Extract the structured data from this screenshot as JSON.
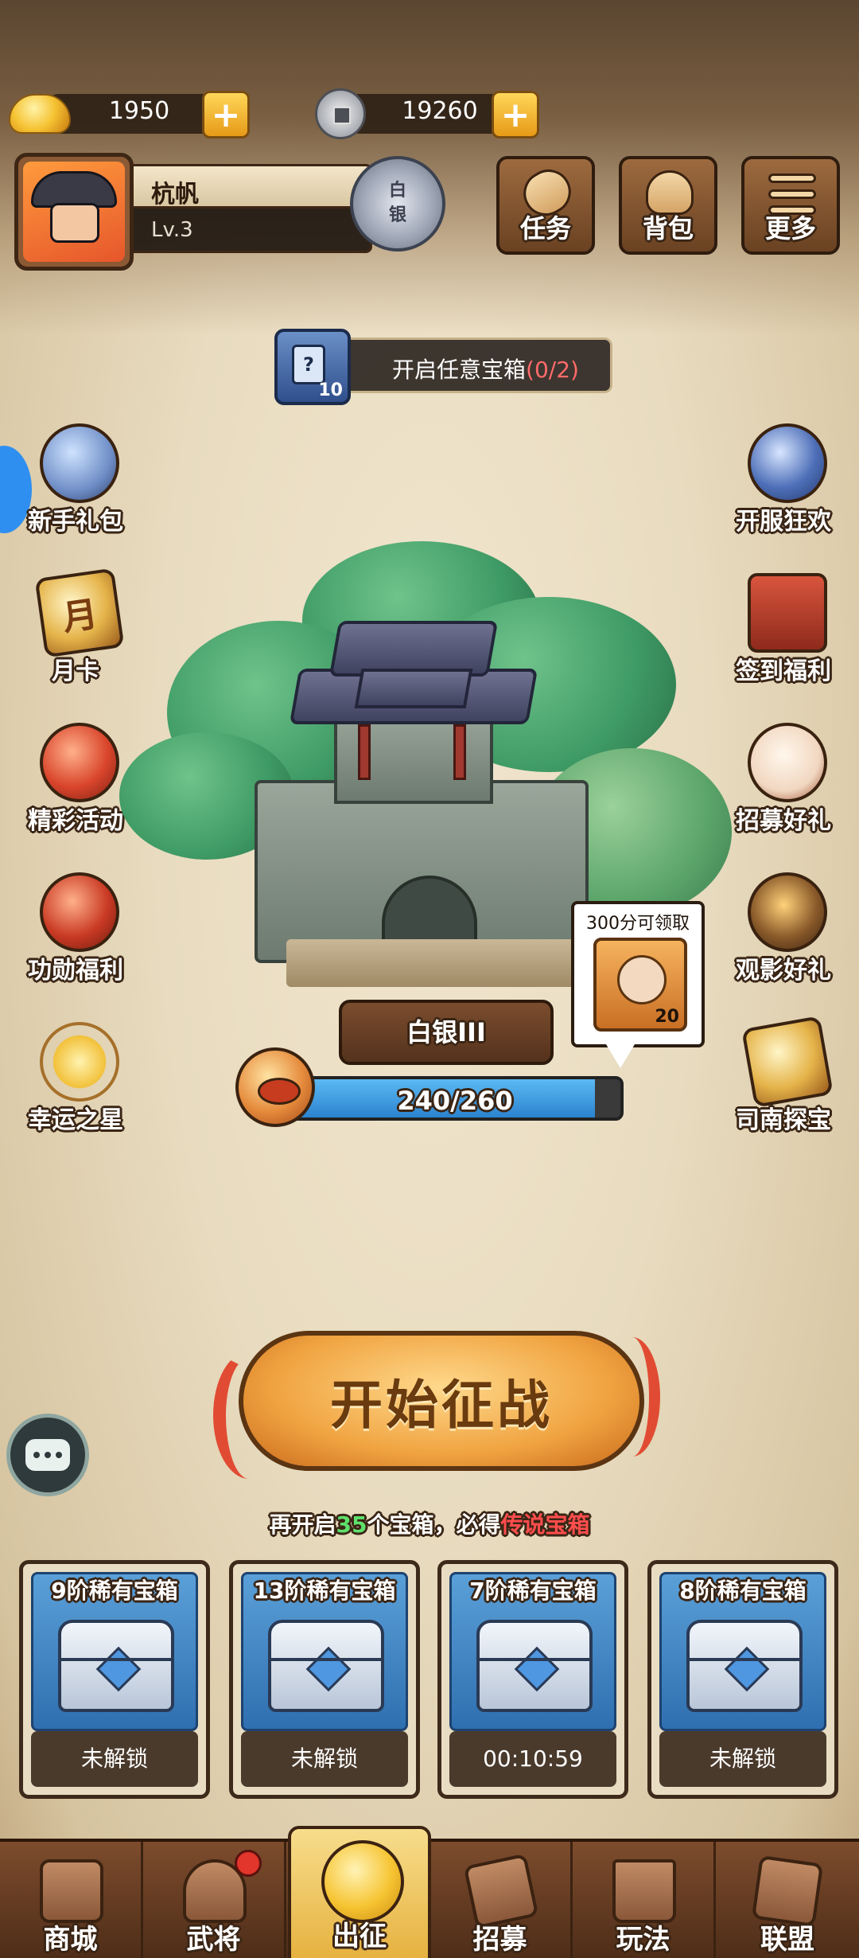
{
  "currency": {
    "gold": "1950",
    "silver": "19260"
  },
  "player": {
    "name": "杭帆",
    "level": "Lv.3",
    "rank_badge": [
      "白",
      "银"
    ]
  },
  "top_buttons": {
    "tasks": "任务",
    "bag": "背包",
    "more": "更多"
  },
  "mission": {
    "card_glyph": "?",
    "card_count": "10",
    "text": "开启任意宝箱",
    "progress": "(0/2)"
  },
  "left_activities": [
    {
      "label": "新手礼包",
      "icon": "hero-gift-icon"
    },
    {
      "label": "月卡",
      "icon": "monthly-card-icon",
      "glyph": "月"
    },
    {
      "label": "精彩活动",
      "icon": "event-bag-icon"
    },
    {
      "label": "功勋福利",
      "icon": "merit-bag-icon"
    },
    {
      "label": "幸运之星",
      "icon": "lucky-star-icon"
    }
  ],
  "right_activities": [
    {
      "label": "开服狂欢",
      "icon": "server-celebration-icon"
    },
    {
      "label": "签到福利",
      "icon": "sign-in-icon"
    },
    {
      "label": "招募好礼",
      "icon": "recruit-drum-icon"
    },
    {
      "label": "观影好礼",
      "icon": "video-reward-icon"
    },
    {
      "label": "司南探宝",
      "icon": "compass-treasure-icon"
    }
  ],
  "rank": {
    "name": "白银III",
    "xp_text": "240/260",
    "xp_current": 240,
    "xp_max": 260
  },
  "reward_bubble": {
    "title": "300分可领取",
    "count": "20"
  },
  "start_button": "开始征战",
  "hint": {
    "prefix": "再开启",
    "number": "35",
    "middle": "个宝箱，必得",
    "reward": "传说宝箱"
  },
  "chests": [
    {
      "title": "9阶稀有宝箱",
      "status": "未解锁"
    },
    {
      "title": "13阶稀有宝箱",
      "status": "未解锁"
    },
    {
      "title": "7阶稀有宝箱",
      "status": "00:10:59"
    },
    {
      "title": "8阶稀有宝箱",
      "status": "未解锁"
    }
  ],
  "bottom_nav": [
    {
      "label": "商城",
      "icon": "shop-icon"
    },
    {
      "label": "武将",
      "icon": "general-helmet-icon"
    },
    {
      "label": "出征",
      "icon": "expedition-icon"
    },
    {
      "label": "招募",
      "icon": "recruit-scroll-icon"
    },
    {
      "label": "玩法",
      "icon": "gameplay-pavilion-icon"
    },
    {
      "label": "联盟",
      "icon": "alliance-icon"
    }
  ],
  "colors": {
    "progress_blue": "#3a9ae3",
    "hint_number_green": "#5ee06b",
    "hint_reward_red": "#ff4d4d",
    "nav_active_gold": "#f0c45a"
  }
}
